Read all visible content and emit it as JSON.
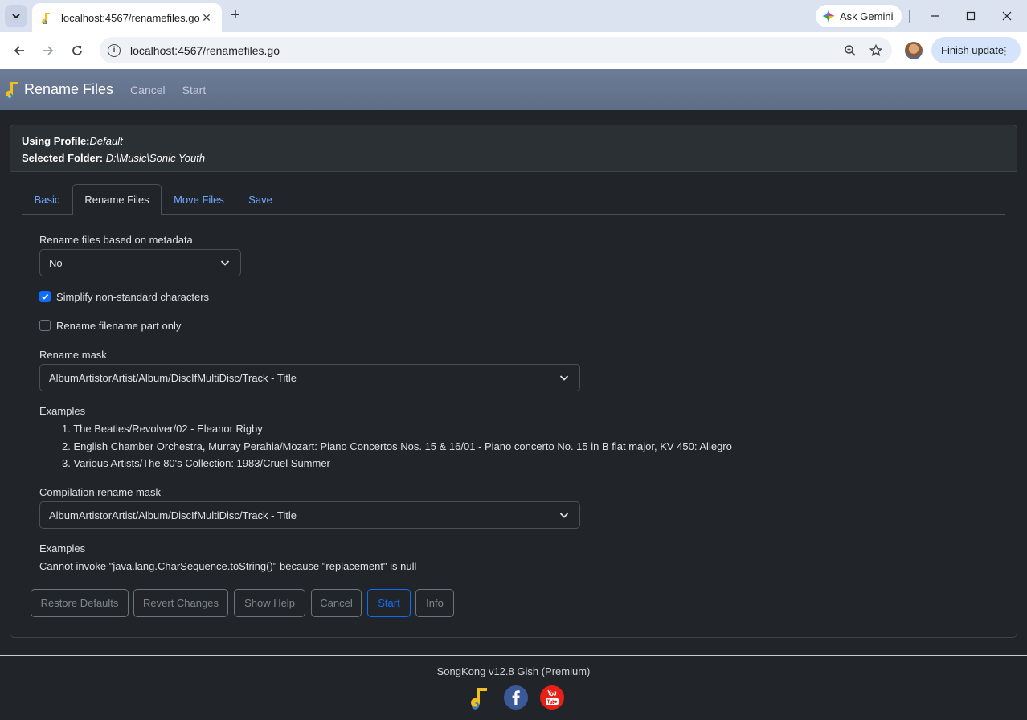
{
  "browser": {
    "tab_title": "localhost:4567/renamefiles.go",
    "url": "localhost:4567/renamefiles.go",
    "gemini_label": "Ask Gemini",
    "finish_update_label": "Finish update"
  },
  "navbar": {
    "brand": "Rename Files",
    "links": [
      "Cancel",
      "Start"
    ]
  },
  "header": {
    "profile_label": "Using Profile:",
    "profile_value": "Default",
    "folder_label": "Selected Folder:",
    "folder_value": "D:\\Music\\Sonic Youth"
  },
  "tabs": [
    {
      "label": "Basic",
      "active": false
    },
    {
      "label": "Rename Files",
      "active": true
    },
    {
      "label": "Move Files",
      "active": false
    },
    {
      "label": "Save",
      "active": false
    }
  ],
  "form": {
    "rename_metadata_label": "Rename files based on metadata",
    "rename_metadata_value": "No",
    "simplify_label": "Simplify non-standard characters",
    "simplify_checked": true,
    "filename_only_label": "Rename filename part only",
    "filename_only_checked": false,
    "rename_mask_label": "Rename mask",
    "rename_mask_value": "AlbumArtistorArtist/Album/DiscIfMultiDisc/Track - Title",
    "examples_label": "Examples",
    "examples": [
      "1. The Beatles/Revolver/02 - Eleanor Rigby",
      "2. English Chamber Orchestra, Murray Perahia/Mozart: Piano Concertos Nos. 15 & 16/01 - Piano concerto No. 15 in B flat major, KV 450: Allegro",
      "3. Various Artists/The 80's Collection: 1983/Cruel Summer"
    ],
    "compilation_mask_label": "Compilation rename mask",
    "compilation_mask_value": "AlbumArtistorArtist/Album/DiscIfMultiDisc/Track - Title",
    "compilation_examples_label": "Examples",
    "compilation_error": "Cannot invoke \"java.lang.CharSequence.toString()\" because \"replacement\" is null"
  },
  "buttons": {
    "restore": "Restore Defaults",
    "revert": "Revert Changes",
    "help": "Show Help",
    "cancel": "Cancel",
    "start": "Start",
    "info": "Info"
  },
  "footer": {
    "version": "SongKong v12.8 Gish (Premium)"
  },
  "colors": {
    "accent": "#0d6efd",
    "tab_link": "#6ea8fe",
    "navbar": "#64738d",
    "page_bg": "#212529"
  }
}
